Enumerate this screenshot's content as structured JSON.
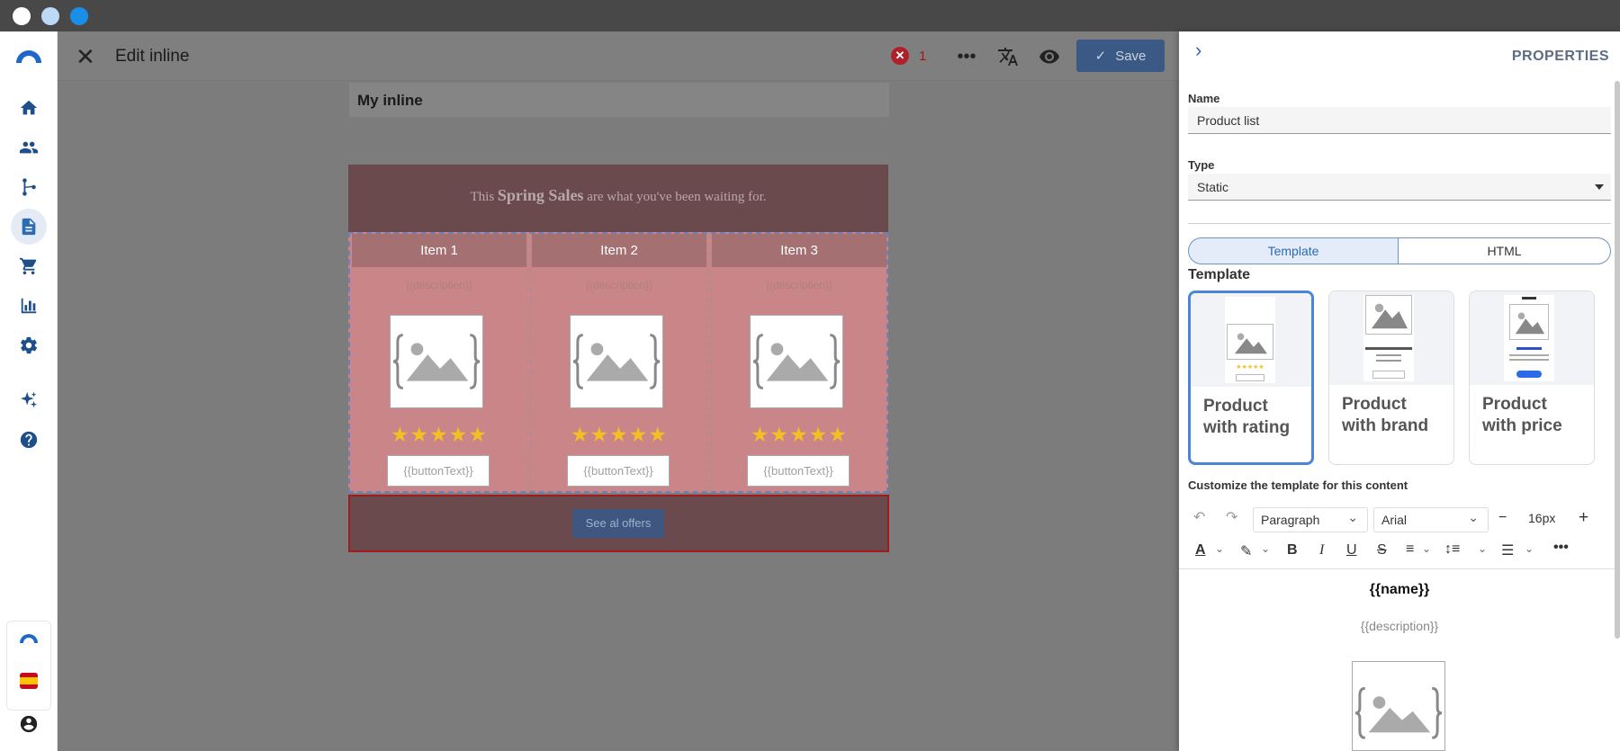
{
  "window": {
    "dot_colors": [
      "#ffffff",
      "#bcd9f6",
      "#1a8fea"
    ]
  },
  "sidebar": {
    "items": [
      "home-icon",
      "people-icon",
      "flow-icon",
      "document-icon",
      "cart-icon",
      "chart-icon",
      "gear-icon",
      "sparkle-icon",
      "help-icon"
    ],
    "active": "document-icon",
    "bottom": [
      "company-logo",
      "spain-flag-icon",
      "user-icon"
    ]
  },
  "header": {
    "title": "Edit inline",
    "error_count": "1",
    "error_symbol": "✕",
    "save_label": "Save"
  },
  "canvas": {
    "inline_name": "My inline",
    "banner": {
      "pre": "This ",
      "highlight": "Spring Sales",
      "post": " are what you've been waiting for."
    },
    "products": [
      {
        "title": "Item 1",
        "description": "{{description}}",
        "stars": "★★★★★",
        "button": "{{buttonText}}"
      },
      {
        "title": "Item 2",
        "description": "{{description}}",
        "stars": "★★★★★",
        "button": "{{buttonText}}"
      },
      {
        "title": "Item 3",
        "description": "{{description}}",
        "stars": "★★★★★",
        "button": "{{buttonText}}"
      }
    ],
    "offers_label": "See al offers"
  },
  "properties": {
    "title": "PROPERTIES",
    "name_label": "Name",
    "name_value": "Product list",
    "type_label": "Type",
    "type_value": "Static",
    "tabs": {
      "template": "Template",
      "html": "HTML",
      "active": "template"
    },
    "template_heading": "Template",
    "templates": [
      {
        "line1": "Product",
        "line2": "with rating",
        "selected": true
      },
      {
        "line1": "Product",
        "line2": "with brand",
        "selected": false
      },
      {
        "line1": "Product",
        "line2": "with price",
        "selected": false
      }
    ],
    "customize_label": "Customize the template for this content",
    "toolbar": {
      "block_format": "Paragraph",
      "font_family": "Arial",
      "font_size": "16px",
      "minus": "−",
      "plus": "+"
    },
    "preview": {
      "name": "{{name}}",
      "description": "{{description}}"
    }
  },
  "colors": {
    "accent": "#2b6ab5",
    "error": "#b0202b",
    "star": "#f3bf25"
  }
}
